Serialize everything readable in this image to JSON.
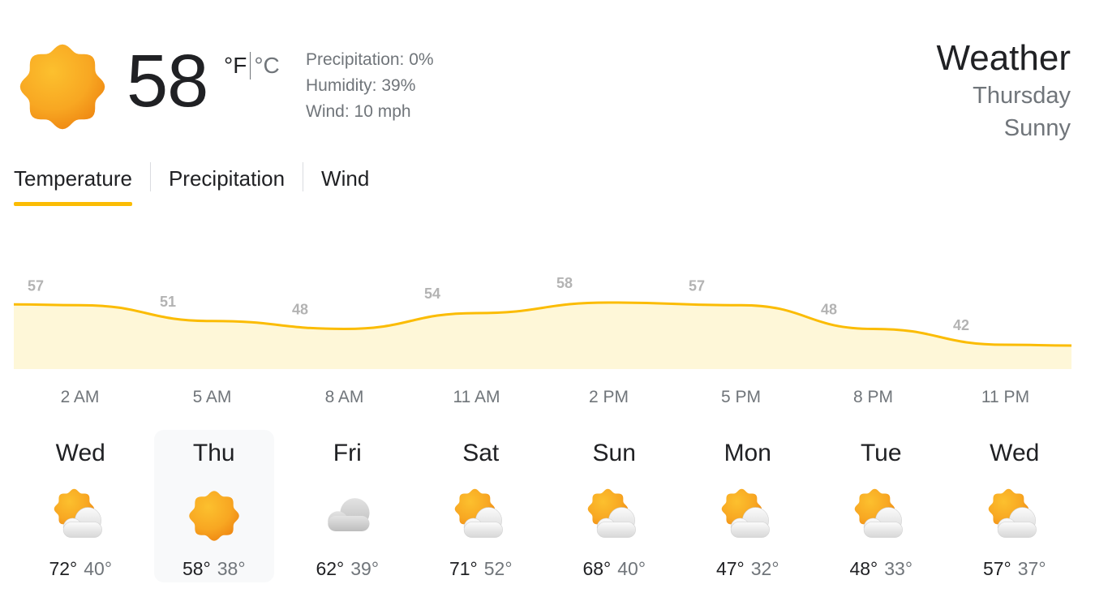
{
  "current": {
    "temperature": "58",
    "unit_f": "°F",
    "unit_c": "°C",
    "icon": "sunny-icon",
    "precipitation": "Precipitation: 0%",
    "humidity": "Humidity: 39%",
    "wind": "Wind: 10 mph"
  },
  "header": {
    "title": "Weather",
    "day": "Thursday",
    "condition": "Sunny"
  },
  "tabs": [
    {
      "label": "Temperature",
      "active": true
    },
    {
      "label": "Precipitation",
      "active": false
    },
    {
      "label": "Wind",
      "active": false
    }
  ],
  "colors": {
    "line": "#fbbc04",
    "fill": "#fef7d8",
    "label": "#b3b3b3",
    "sun": "#fbb12a",
    "sun_dark": "#f08c0c"
  },
  "chart_data": {
    "type": "area",
    "x": [
      "2 AM",
      "5 AM",
      "8 AM",
      "11 AM",
      "2 PM",
      "5 PM",
      "8 PM",
      "11 PM"
    ],
    "values": [
      57,
      51,
      48,
      54,
      58,
      57,
      48,
      42
    ],
    "labels": [
      "57",
      "51",
      "48",
      "54",
      "58",
      "57",
      "48",
      "42"
    ],
    "xlabel": "",
    "ylabel": "",
    "grid": false
  },
  "days": [
    {
      "name": "Wed",
      "icon": "partly-cloudy-icon",
      "high": "72°",
      "low": "40°",
      "selected": false
    },
    {
      "name": "Thu",
      "icon": "sunny-icon",
      "high": "58°",
      "low": "38°",
      "selected": true
    },
    {
      "name": "Fri",
      "icon": "cloudy-icon",
      "high": "62°",
      "low": "39°",
      "selected": false
    },
    {
      "name": "Sat",
      "icon": "partly-cloudy-icon",
      "high": "71°",
      "low": "52°",
      "selected": false
    },
    {
      "name": "Sun",
      "icon": "partly-cloudy-icon",
      "high": "68°",
      "low": "40°",
      "selected": false
    },
    {
      "name": "Mon",
      "icon": "partly-cloudy-icon",
      "high": "47°",
      "low": "32°",
      "selected": false
    },
    {
      "name": "Tue",
      "icon": "partly-cloudy-icon",
      "high": "48°",
      "low": "33°",
      "selected": false
    },
    {
      "name": "Wed",
      "icon": "partly-cloudy-icon",
      "high": "57°",
      "low": "37°",
      "selected": false
    }
  ]
}
